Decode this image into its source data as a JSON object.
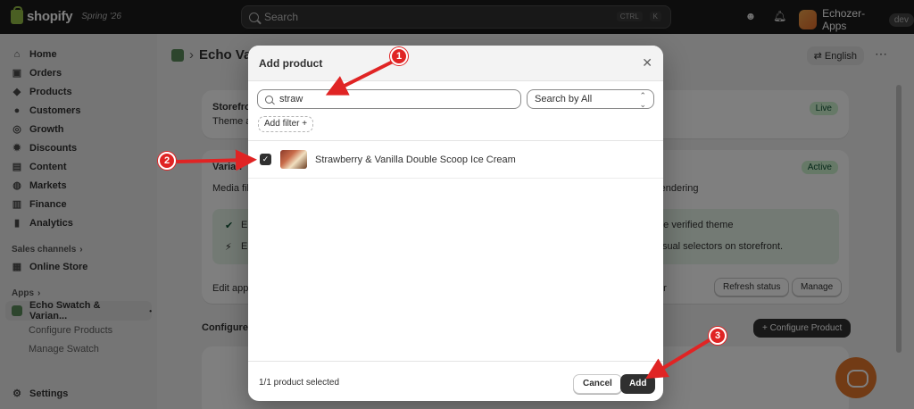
{
  "topbar": {
    "brand": "shopify",
    "edition": "Spring '26",
    "search_placeholder": "Search",
    "shortcut_keys": [
      "CTRL",
      "K"
    ],
    "store_name": "Echozer-Apps",
    "store_badge": "dev"
  },
  "sidebar": {
    "items": [
      {
        "label": "Home",
        "icon": "home-icon"
      },
      {
        "label": "Orders",
        "icon": "orders-icon"
      },
      {
        "label": "Products",
        "icon": "tag-icon"
      },
      {
        "label": "Customers",
        "icon": "person-icon"
      },
      {
        "label": "Growth",
        "icon": "target-icon"
      },
      {
        "label": "Discounts",
        "icon": "discount-icon"
      },
      {
        "label": "Content",
        "icon": "content-icon"
      },
      {
        "label": "Markets",
        "icon": "globe-icon"
      },
      {
        "label": "Finance",
        "icon": "bank-icon"
      },
      {
        "label": "Analytics",
        "icon": "chart-icon"
      }
    ],
    "sales_channels_label": "Sales channels",
    "online_store_label": "Online Store",
    "apps_label": "Apps",
    "app_name": "Echo Swatch & Varian...",
    "app_sub_items": [
      "Configure Products",
      "Manage Swatch"
    ],
    "settings_label": "Settings"
  },
  "background_page": {
    "title_fragment": "Echo Var",
    "language_button": "English",
    "card1_title_fragment": "Storefro",
    "card1_sub_fragment": "Theme a",
    "card1_badge": "Live",
    "card2_title_fragment": "Varian",
    "card2_badge": "Active",
    "card2_text_left": "Media fil",
    "card2_text_right": "rendering",
    "green_row1_fragment": "the verified theme",
    "green_row2_fragment": "visual selectors on storefront.",
    "green_row1_lead": "E",
    "green_row2_lead": "E",
    "edit_app_fragment": "Edit app",
    "edit_app_end": "or",
    "refresh_button": "Refresh status",
    "manage_button": "Manage",
    "configure_heading_fragment": "Configure I",
    "configure_button": "+ Configure Product"
  },
  "modal": {
    "title": "Add product",
    "search_value": "straw",
    "search_by_select": "Search by All",
    "add_filter_label": "Add filter +",
    "products": [
      {
        "name": "Strawberry & Vanilla Double Scoop Ice Cream",
        "checked": true
      }
    ],
    "selected_count_text": "1/1 product selected",
    "cancel_label": "Cancel",
    "add_label": "Add"
  },
  "annotations": {
    "steps": [
      "1",
      "2",
      "3"
    ],
    "color": "#e02424"
  },
  "colors": {
    "topbar_bg": "#1a1a1a",
    "success_badge_bg": "#cdf2cf",
    "primary_button": "#303030",
    "annotation_red": "#e02424"
  }
}
